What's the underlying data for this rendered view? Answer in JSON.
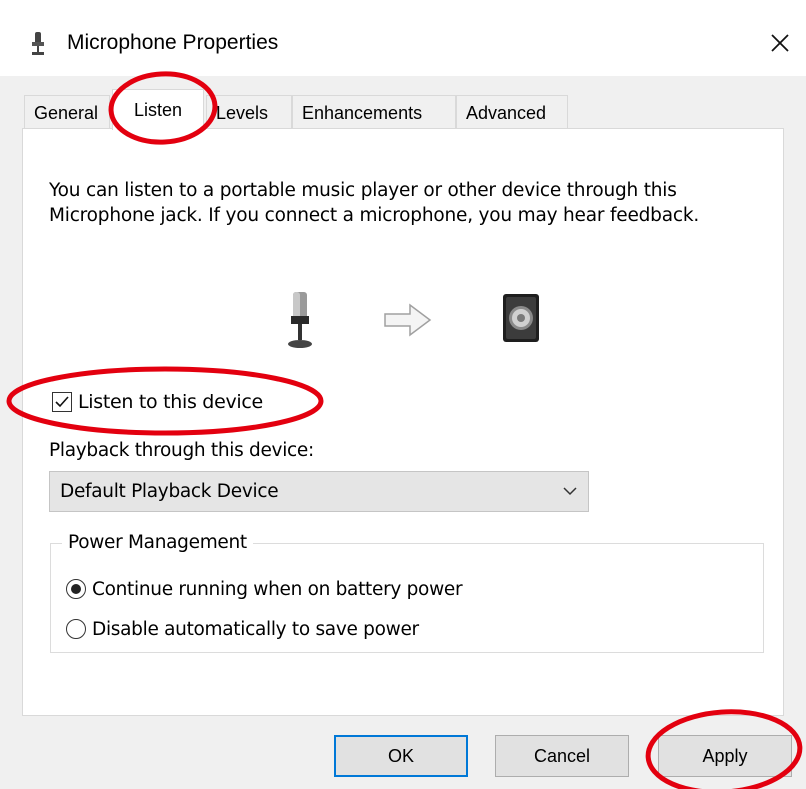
{
  "dialog": {
    "title": "Microphone Properties",
    "close_glyph": "✕"
  },
  "tabs": [
    {
      "label": "General",
      "active": false
    },
    {
      "label": "Listen",
      "active": true
    },
    {
      "label": "Levels",
      "active": false
    },
    {
      "label": "Enhancements",
      "active": false
    },
    {
      "label": "Advanced",
      "active": false
    }
  ],
  "listen": {
    "description": "You can listen to a portable music player or other device through this Microphone jack.  If you connect a microphone, you may hear feedback.",
    "listen_checkbox": {
      "label": "Listen to this device",
      "checked": true
    },
    "playback_label": "Playback through this device:",
    "playback_select": {
      "value": "Default Playback Device"
    },
    "power_management": {
      "legend": "Power Management",
      "options": [
        {
          "label": "Continue running when on battery power",
          "checked": true
        },
        {
          "label": "Disable automatically to save power",
          "checked": false
        }
      ]
    }
  },
  "buttons": {
    "ok": "OK",
    "cancel": "Cancel",
    "apply": "Apply"
  },
  "colors": {
    "annotation": "#e3000f",
    "default_button_border": "#0078d7",
    "dialog_bg": "#f0f0f0"
  },
  "icons": [
    "microphone-icon",
    "arrow-right-icon",
    "speaker-icon",
    "chevron-down-icon",
    "close-icon"
  ]
}
